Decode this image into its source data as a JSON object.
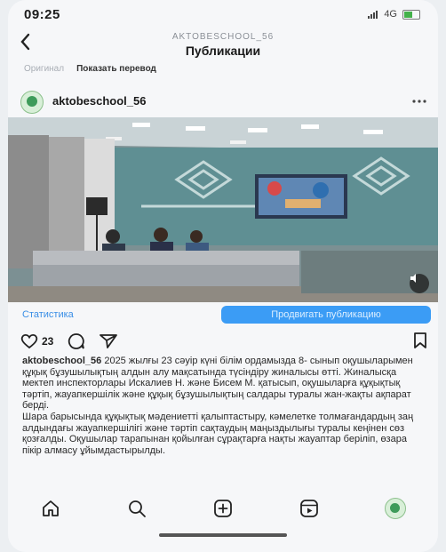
{
  "status_bar": {
    "time": "09:25",
    "network": "4G"
  },
  "header": {
    "account": "AKTOBESCHOOL_56",
    "title": "Публикации",
    "back_icon": "chevron-left-icon"
  },
  "translate_bar": {
    "original_label": "Оригинал",
    "translate_label": "Показать перевод"
  },
  "post": {
    "username": "aktobeschool_56",
    "more_icon": "more-horizontal-icon",
    "stats_label": "Статистика",
    "promote_label": "Продвигать публикацию",
    "likes": "23",
    "caption_user": "aktobeschool_56",
    "caption_text": "2025 жылғы 23 сәуір күні білім ордамызда 8- сынып оқушыларымен құқық бұзушылықтың алдын алу мақсатында түсіндіру жиналысы өтті. Жиналысқа мектеп инспекторлары Искалиев Н. және Бисем М. қатысып, оқушыларға құқықтық тәртіп, жауапкершілік және құқық бұзушылықтың салдары туралы жан-жақты ақпарат берді.",
    "caption_text_2": "Шара барысында құқықтық мәдениетті қалыптастыру, кәмелетке толмағандардың заң алдындағы жауапкершілігі және тәртіп сақтаудың маңыздылығы туралы кеңінен сөз қозғалды. Оқушылар тарапынан қойылған сұрақтарға нақты жауаптар беріліп, өзара пікір алмасу ұйымдастырылды."
  },
  "bottom_nav": {
    "items": [
      "home-icon",
      "search-icon",
      "create-icon",
      "reels-icon",
      "profile-avatar"
    ]
  },
  "colors": {
    "accent": "#3b9cf5",
    "link": "#3a8ee6",
    "hall_wall": "#5f8f93"
  }
}
